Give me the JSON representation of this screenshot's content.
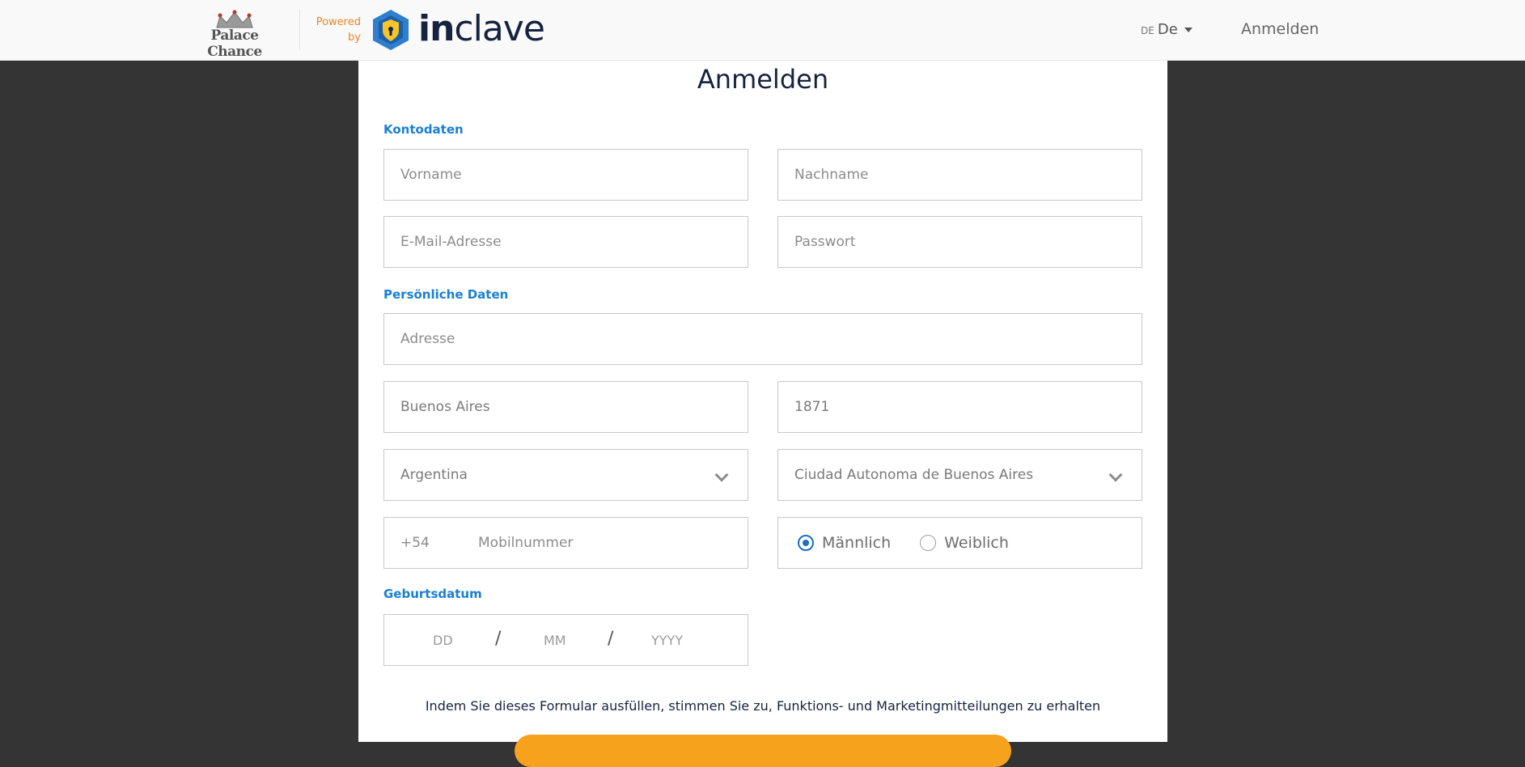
{
  "header": {
    "brand": "Palace Chance",
    "powered_by": "Powered by",
    "provider_name_a": "in",
    "provider_name_b": "clave",
    "language_code": "DE",
    "language_label": "De",
    "login_link": "Anmelden"
  },
  "form": {
    "title": "Anmelden",
    "account_section": "Kontodaten",
    "first_name_placeholder": "Vorname",
    "last_name_placeholder": "Nachname",
    "email_placeholder": "E-Mail-Adresse",
    "password_placeholder": "Passwort",
    "personal_section": "Persönliche Daten",
    "address_placeholder": "Adresse",
    "city_value": "Buenos Aires",
    "zip_value": "1871",
    "country_value": "Argentina",
    "province_value": "Ciudad Autonoma de Buenos Aires",
    "phone_code": "+54",
    "phone_placeholder": "Mobilnummer",
    "gender_male": "Männlich",
    "gender_female": "Weiblich",
    "gender_selected": "Männlich",
    "dob_section": "Geburtsdatum",
    "dob_day": "DD",
    "dob_month": "MM",
    "dob_year": "YYYY",
    "dob_separator": "/",
    "consent_text": "Indem Sie dieses Formular ausfüllen, stimmen Sie zu, Funktions- und Marketingmitteilungen zu erhalten"
  },
  "colors": {
    "accent": "#1a7fd3",
    "button": "#f7a21c",
    "powered_by": "#e8862a"
  }
}
